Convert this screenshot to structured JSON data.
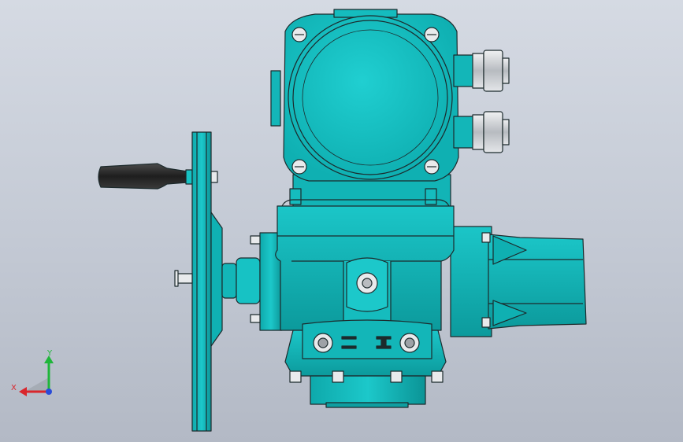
{
  "viewport": {
    "background_top": "#d5dae3",
    "background_bottom": "#b3b9c5"
  },
  "model": {
    "body_color": "#17c2c4",
    "body_dark": "#0a8c8e",
    "outline_color": "#1c2a2c",
    "handle_color": "#2b2b2b",
    "gland_color": "#cfd2d6"
  },
  "triad": {
    "y_label": "Y",
    "x_label": "X",
    "y_color": "#1fb63a",
    "x_color": "#d9262c",
    "z_color": "#2a4bd8"
  }
}
